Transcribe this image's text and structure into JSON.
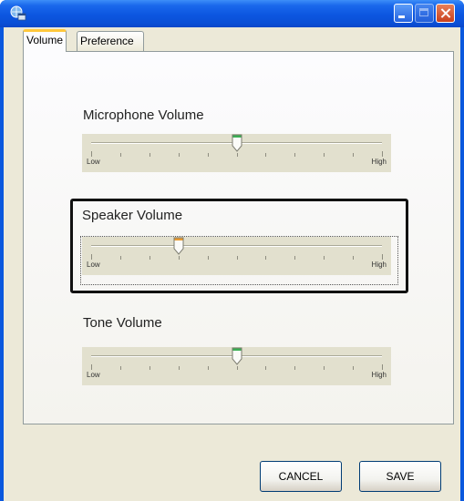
{
  "window": {
    "title": "",
    "icons": {
      "app": "globe-window-icon",
      "minimize": "minimize-icon",
      "maximize": "maximize-icon",
      "close": "close-icon"
    },
    "colors": {
      "titlebar": "#0a58de",
      "client": "#ece9d8",
      "close_button": "#d7582c",
      "active_tab_accent": "#ffc83c",
      "thumb_green": "#3cae54",
      "thumb_orange": "#e89a32"
    }
  },
  "tabs": [
    {
      "label": "Volume",
      "selected": true
    },
    {
      "label": "Preference",
      "selected": false
    }
  ],
  "volumes": {
    "microphone": {
      "label": "Microphone Volume",
      "low": "Low",
      "high": "High",
      "level": 0.5
    },
    "speaker": {
      "label": "Speaker Volume",
      "low": "Low",
      "high": "High",
      "level": 0.3,
      "focused": true
    },
    "tone": {
      "label": "Tone Volume",
      "low": "Low",
      "high": "High",
      "level": 0.5
    }
  },
  "buttons": {
    "cancel": "CANCEL",
    "save": "SAVE"
  }
}
